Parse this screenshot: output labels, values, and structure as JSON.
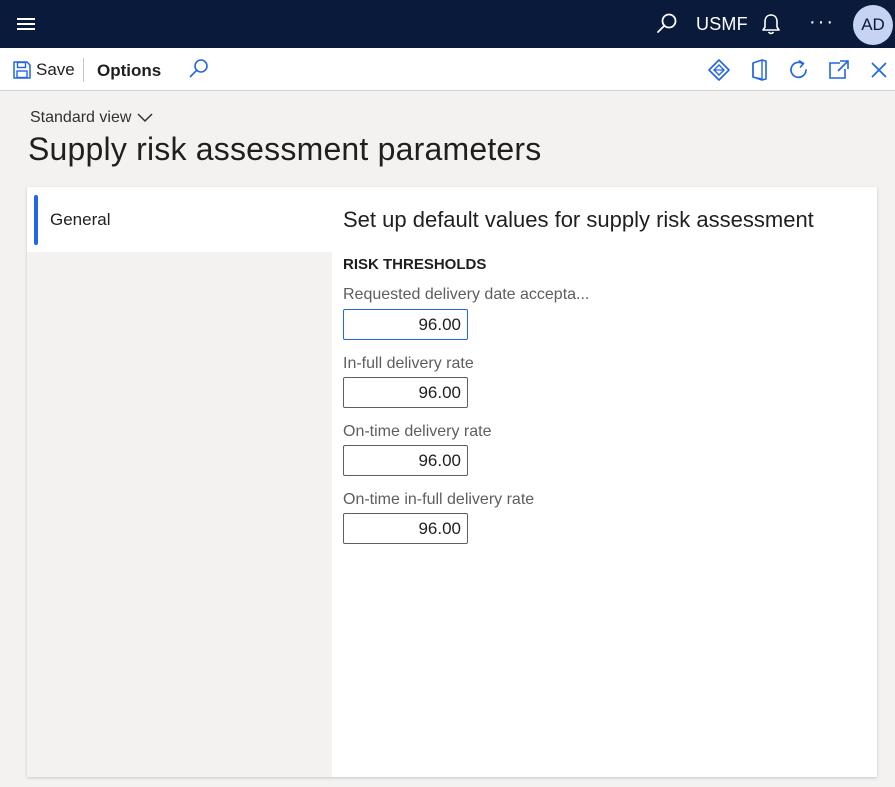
{
  "topbar": {
    "company": "USMF",
    "avatar_initials": "AD",
    "more_label": "···"
  },
  "actionbar": {
    "save_label": "Save",
    "options_label": "Options"
  },
  "page": {
    "view_label": "Standard view",
    "title": "Supply risk assessment parameters"
  },
  "nav": {
    "items": [
      {
        "label": "General",
        "selected": true
      }
    ]
  },
  "content": {
    "section_heading": "Set up default values for supply risk assessment",
    "group_heading": "RISK THRESHOLDS",
    "fields": [
      {
        "label": "Requested delivery date accepta...",
        "value": "96.00"
      },
      {
        "label": "In-full delivery rate",
        "value": "96.00"
      },
      {
        "label": "On-time delivery rate",
        "value": "96.00"
      },
      {
        "label": "On-time in-full delivery rate",
        "value": "96.00"
      }
    ]
  },
  "colors": {
    "topbar_bg": "#0a1a3a",
    "accent": "#2266e3",
    "avatar_bg": "#c7d3f3"
  }
}
